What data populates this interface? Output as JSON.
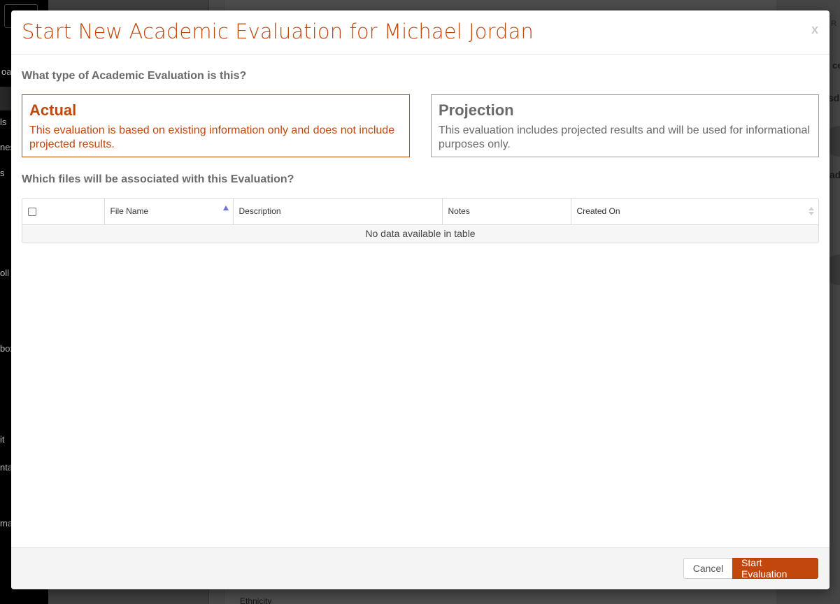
{
  "background": {
    "sidebar_fragments": [
      "oa",
      "ls",
      "nes",
      "s",
      "oll",
      "box",
      "it",
      "nta",
      "ma"
    ],
    "right_fragments": [
      "t R",
      "ce",
      "sda",
      "ad"
    ],
    "bottom_label": "Ethnicity"
  },
  "modal": {
    "title": "Start New Academic Evaluation for Michael Jordan",
    "close_label": "x",
    "question_type": "What type of Academic Evaluation is this?",
    "options": [
      {
        "title": "Actual",
        "description": "This evaluation is based on existing information only and does not include projected results.",
        "selected": true
      },
      {
        "title": "Projection",
        "description": "This evaluation includes projected results and will be used for informational purposes only.",
        "selected": false
      }
    ],
    "question_files": "Which files will be associated with this Evaluation?",
    "table": {
      "columns": [
        "File Name",
        "Description",
        "Notes",
        "Created On"
      ],
      "empty_message": "No data available in table"
    },
    "footer": {
      "cancel_label": "Cancel",
      "start_label": "Start Evaluation"
    }
  },
  "colors": {
    "accent": "#c1470c",
    "sort_active": "#6a76c9"
  }
}
